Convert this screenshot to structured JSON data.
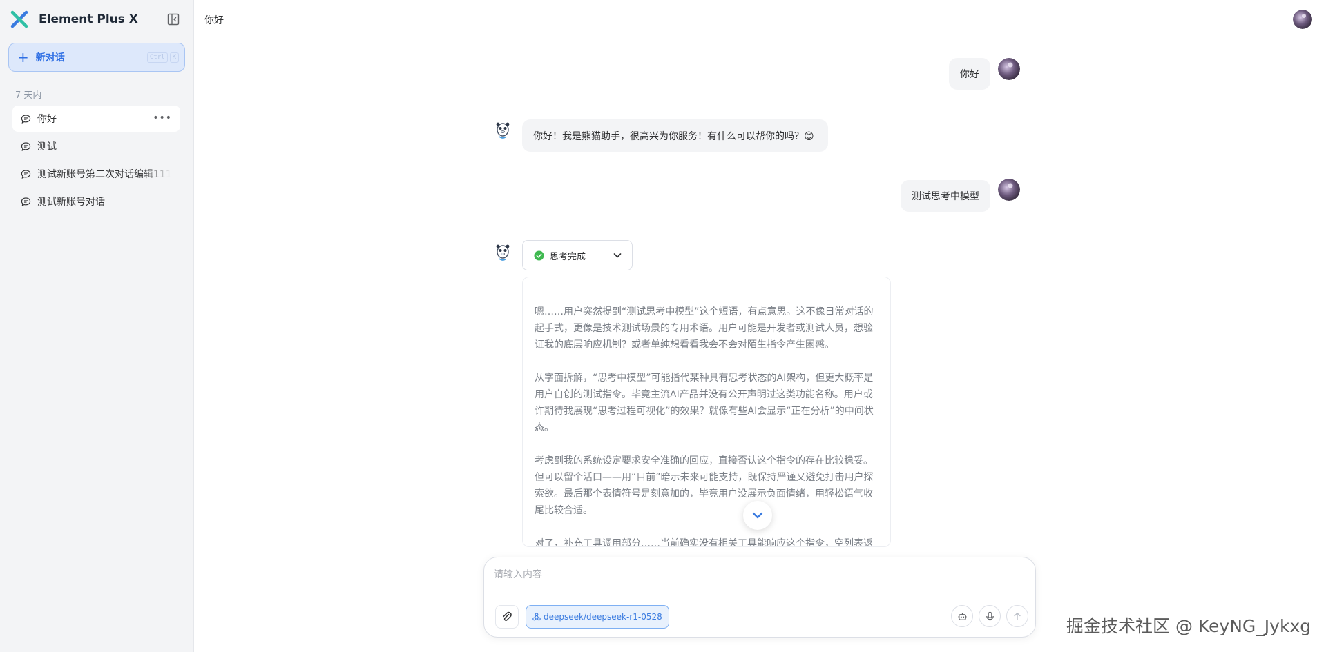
{
  "app": {
    "brand_name": "Element Plus X",
    "brand_colors": [
      "#30c0a6",
      "#3a7be0"
    ]
  },
  "sidebar": {
    "new_chat_label": "新对话",
    "shortcut_keys": [
      "Ctrl",
      "K"
    ],
    "group_title": "7 天内",
    "conversations": [
      {
        "label": "你好",
        "active": true
      },
      {
        "label": "测试",
        "active": false
      },
      {
        "label": "测试新账号第二次对话编辑111",
        "active": false
      },
      {
        "label": "测试新账号对话",
        "active": false
      }
    ]
  },
  "header": {
    "title": "你好"
  },
  "messages": {
    "user_1": "你好",
    "bot_1": "你好！我是熊猫助手，很高兴为你服务！有什么可以帮你的吗？😊",
    "user_2": "测试思考中模型",
    "thinking_status": "思考完成",
    "reasoning": [
      "嗯……用户突然提到“测试思考中模型”这个短语，有点意思。这不像日常对话的起手式，更像是技术测试场景的专用术语。用户可能是开发者或测试人员，想验证我的底层响应机制？或者单纯想看看我会不会对陌生指令产生困惑。",
      "从字面拆解，“思考中模型”可能指代某种具有思考状态的AI架构，但更大概率是用户自创的测试指令。毕竟主流AI产品并没有公开声明过这类功能名称。用户或许期待我展现“思考过程可视化”的效果？就像有些AI会显示“正在分析”的中间状态。",
      "考虑到我的系统设定要求安全准确的回应，直接否认这个指令的存在比较稳妥。但可以留个活口——用“目前”暗示未来可能支持，既保持严谨又避免打击用户探索欲。最后那个表情符号是刻意加的，毕竟用户没展示负面情绪，用轻松语气收尾比较合适。",
      "对了，补充工具调用部分……当前确实没有相关工具能响应这个指令，空列表返回"
    ]
  },
  "input": {
    "placeholder": "请输入内容",
    "model_name": "deepseek/deepseek-r1-0528"
  },
  "watermark": "掘金技术社区 @ KeyNG_Jykxg"
}
